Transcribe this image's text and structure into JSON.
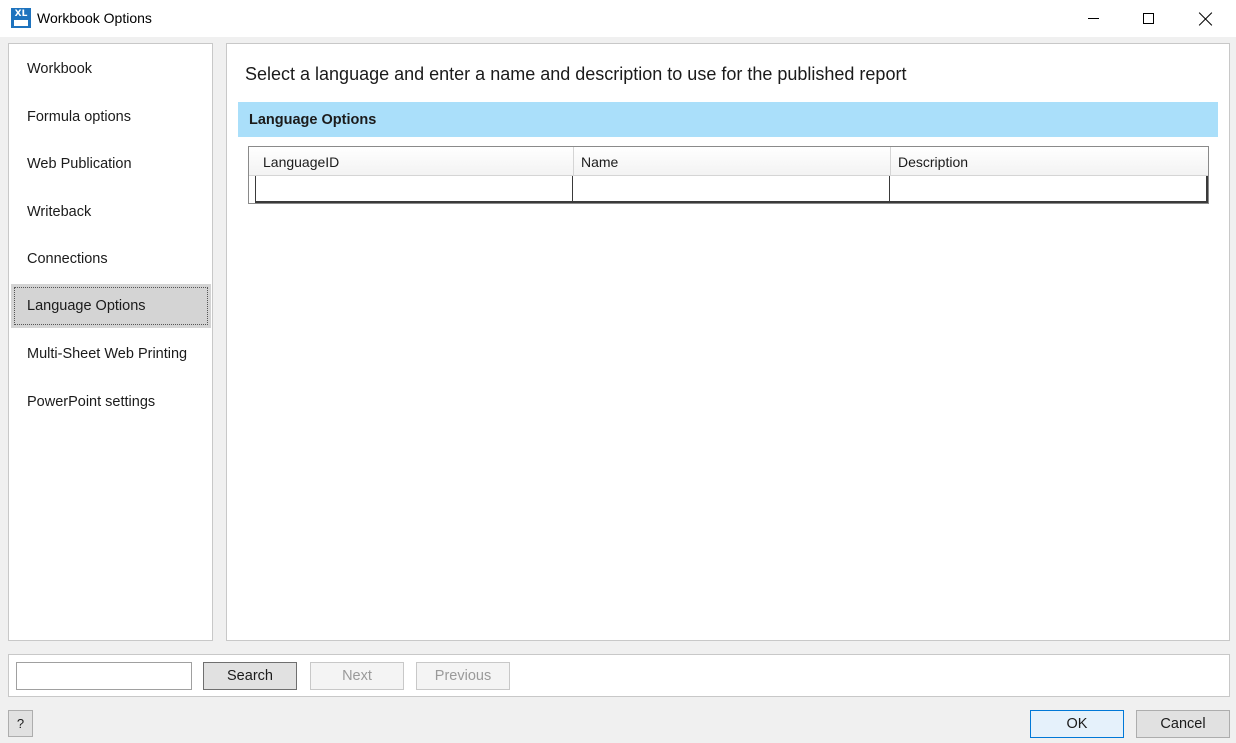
{
  "window": {
    "title": "Workbook Options",
    "icon_text": "XL",
    "controls": {
      "minimize_icon": "minimize-icon",
      "maximize_icon": "maximize-icon",
      "close_icon": "close-icon"
    }
  },
  "sidebar": {
    "items": [
      {
        "label": "Workbook",
        "active": false
      },
      {
        "label": "Formula options",
        "active": false
      },
      {
        "label": "Web Publication",
        "active": false
      },
      {
        "label": "Writeback",
        "active": false
      },
      {
        "label": "Connections",
        "active": false
      },
      {
        "label": "Language Options",
        "active": true
      },
      {
        "label": "Multi-Sheet Web Printing",
        "active": false
      },
      {
        "label": "PowerPoint settings",
        "active": false
      }
    ]
  },
  "main": {
    "heading": "Select a language and enter a name and description to use for the published report",
    "section_title": "Language Options",
    "grid": {
      "columns": [
        "LanguageID",
        "Name",
        "Description"
      ],
      "rows": [
        [
          "",
          "",
          ""
        ]
      ]
    }
  },
  "search": {
    "value": "",
    "search_label": "Search",
    "next_label": "Next",
    "previous_label": "Previous"
  },
  "footer": {
    "help_label": "?",
    "ok_label": "OK",
    "cancel_label": "Cancel"
  },
  "colors": {
    "section_header_bg": "#aadffa",
    "active_item_bg": "#d4d4d4",
    "ok_border": "#0078d7",
    "app_icon_bg": "#1e73be"
  }
}
